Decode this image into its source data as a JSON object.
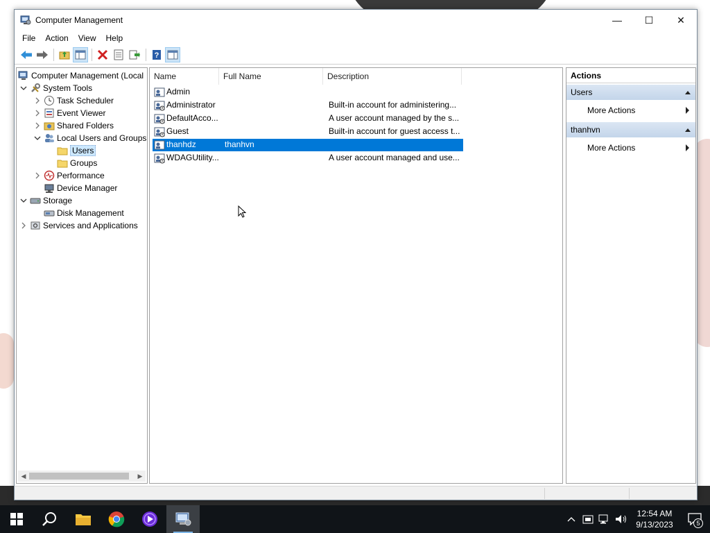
{
  "window": {
    "title": "Computer Management",
    "controls": {
      "minimize": "—",
      "maximize": "☐",
      "close": "✕"
    }
  },
  "menu": [
    "File",
    "Action",
    "View",
    "Help"
  ],
  "tree": {
    "items": [
      {
        "label": "Computer Management (Local",
        "icon": "computer-management-icon",
        "level": 0,
        "expander": ""
      },
      {
        "label": "System Tools",
        "icon": "system-tools-icon",
        "level": 1,
        "expander": "expanded"
      },
      {
        "label": "Task Scheduler",
        "icon": "clock-icon",
        "level": 2,
        "expander": "collapsed"
      },
      {
        "label": "Event Viewer",
        "icon": "event-viewer-icon",
        "level": 2,
        "expander": "collapsed"
      },
      {
        "label": "Shared Folders",
        "icon": "shared-folder-icon",
        "level": 2,
        "expander": "collapsed"
      },
      {
        "label": "Local Users and Groups",
        "icon": "users-groups-icon",
        "level": 2,
        "expander": "expanded"
      },
      {
        "label": "Users",
        "icon": "folder-icon",
        "level": 3,
        "expander": "",
        "selected": true
      },
      {
        "label": "Groups",
        "icon": "folder-icon",
        "level": 3,
        "expander": ""
      },
      {
        "label": "Performance",
        "icon": "performance-icon",
        "level": 2,
        "expander": "collapsed"
      },
      {
        "label": "Device Manager",
        "icon": "device-manager-icon",
        "level": 2,
        "expander": ""
      },
      {
        "label": "Storage",
        "icon": "storage-icon",
        "level": 1,
        "expander": "expanded"
      },
      {
        "label": "Disk Management",
        "icon": "disk-management-icon",
        "level": 2,
        "expander": ""
      },
      {
        "label": "Services and Applications",
        "icon": "services-icon",
        "level": 1,
        "expander": "collapsed"
      }
    ]
  },
  "list": {
    "columns": [
      "Name",
      "Full Name",
      "Description"
    ],
    "rows": [
      {
        "name": "Admin",
        "full_name": "",
        "description": ""
      },
      {
        "name": "Administrator",
        "full_name": "",
        "description": "Built-in account for administering..."
      },
      {
        "name": "DefaultAcco...",
        "full_name": "",
        "description": "A user account managed by the s..."
      },
      {
        "name": "Guest",
        "full_name": "",
        "description": "Built-in account for guest access t..."
      },
      {
        "name": "thanhdz",
        "full_name": "thanhvn",
        "description": "",
        "selected": true
      },
      {
        "name": "WDAGUtility...",
        "full_name": "",
        "description": "A user account managed and use..."
      }
    ]
  },
  "actions": {
    "header": "Actions",
    "sections": [
      {
        "title": "Users",
        "items": [
          "More Actions"
        ]
      },
      {
        "title": "thanhvn",
        "items": [
          "More Actions"
        ]
      }
    ]
  },
  "taskbar": {
    "apps": [
      "start-icon",
      "search-icon",
      "file-explorer-icon",
      "chrome-icon",
      "media-app-icon",
      "computer-management-icon"
    ],
    "clock_time": "12:54 AM",
    "clock_date": "9/13/2023",
    "notification_count": "5"
  },
  "colors": {
    "selection": "#0078d7",
    "section_header": "#c9d9ec",
    "taskbar": "#101418"
  }
}
